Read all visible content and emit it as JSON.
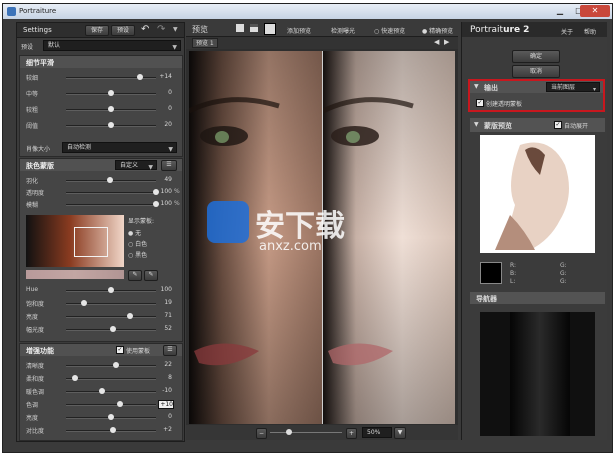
{
  "window": {
    "title": "Portraiture",
    "close_glyph": "✕",
    "minimize_glyph": "▁",
    "maximize_glyph": "□"
  },
  "left_header": {
    "settings": "Settings",
    "save": "保存",
    "preset_btn": "预设",
    "undo_glyph": "↶",
    "redo_glyph": "↷"
  },
  "preset": {
    "label": "预设",
    "value": "默认"
  },
  "detail": {
    "title": "细节平滑",
    "rows": [
      {
        "label": "较细",
        "value": "+14",
        "pct": 0.82
      },
      {
        "label": "中等",
        "value": "0",
        "pct": 0.5
      },
      {
        "label": "较粗",
        "value": "0",
        "pct": 0.5
      },
      {
        "label": "阈值",
        "value": "20",
        "pct": 0.5
      }
    ],
    "size_label": "肖像大小",
    "size_value": "自动检测"
  },
  "mask": {
    "title": "肤色蒙版",
    "mode": "自定义",
    "rows": [
      {
        "label": "羽化",
        "value": "49",
        "unit": "",
        "pct": 0.49
      },
      {
        "label": "透明度",
        "value": "100",
        "unit": "%",
        "pct": 1.0
      },
      {
        "label": "模糊",
        "value": "100",
        "unit": "%",
        "pct": 1.0
      }
    ],
    "show_label": "显示蒙板:",
    "radio_none": "无",
    "radio_white": "白色",
    "radio_black": "黑色",
    "rows2": [
      {
        "label": "Hue",
        "value": "100",
        "pct": 0.5
      },
      {
        "label": "饱和度",
        "value": "19",
        "pct": 0.2
      },
      {
        "label": "亮度",
        "value": "71",
        "pct": 0.71
      },
      {
        "label": "幅光度",
        "value": "52",
        "pct": 0.52
      }
    ]
  },
  "enhance": {
    "title": "增强功能",
    "use_mask": "使用蒙板",
    "rows": [
      {
        "label": "清晰度",
        "value": "22",
        "pct": 0.55
      },
      {
        "label": "柔和度",
        "value": "8",
        "pct": 0.1
      },
      {
        "label": "暖色调",
        "value": "-10",
        "pct": 0.4
      },
      {
        "label": "色调",
        "value": "+10",
        "pct": 0.6
      },
      {
        "label": "亮度",
        "value": "0",
        "pct": 0.5
      },
      {
        "label": "对比度",
        "value": "+2",
        "pct": 0.52
      }
    ]
  },
  "toolbar": {
    "preview": "预览",
    "add_preview": "添加预览",
    "check_exposure": "检测曝光",
    "fast_preview": "快速预览",
    "exact_preview": "精确预览"
  },
  "preview_tab": "预览 1",
  "zoom": {
    "minus": "−",
    "plus": "+",
    "value": "50%"
  },
  "watermark": {
    "text": "安下载",
    "sub": "anxz.com"
  },
  "right": {
    "brand_a": "Portrait",
    "brand_b": "ure 2",
    "about": "关于",
    "help": "帮助",
    "ok": "确定",
    "cancel": "取消",
    "output_title": "输出",
    "output_value": "当前图层",
    "create_mask": "创建透明蒙板",
    "mask_preview_title": "蒙版预览",
    "auto_expand": "自动展开",
    "values": [
      {
        "k": "R:",
        "k2": "G:"
      },
      {
        "k": "B:",
        "k2": "G:"
      },
      {
        "k": "L:",
        "k2": "G:"
      }
    ],
    "navigator": "导航器"
  },
  "colors": {
    "highlight": "#c8171e",
    "accent_blue": "#7fb6ff"
  }
}
